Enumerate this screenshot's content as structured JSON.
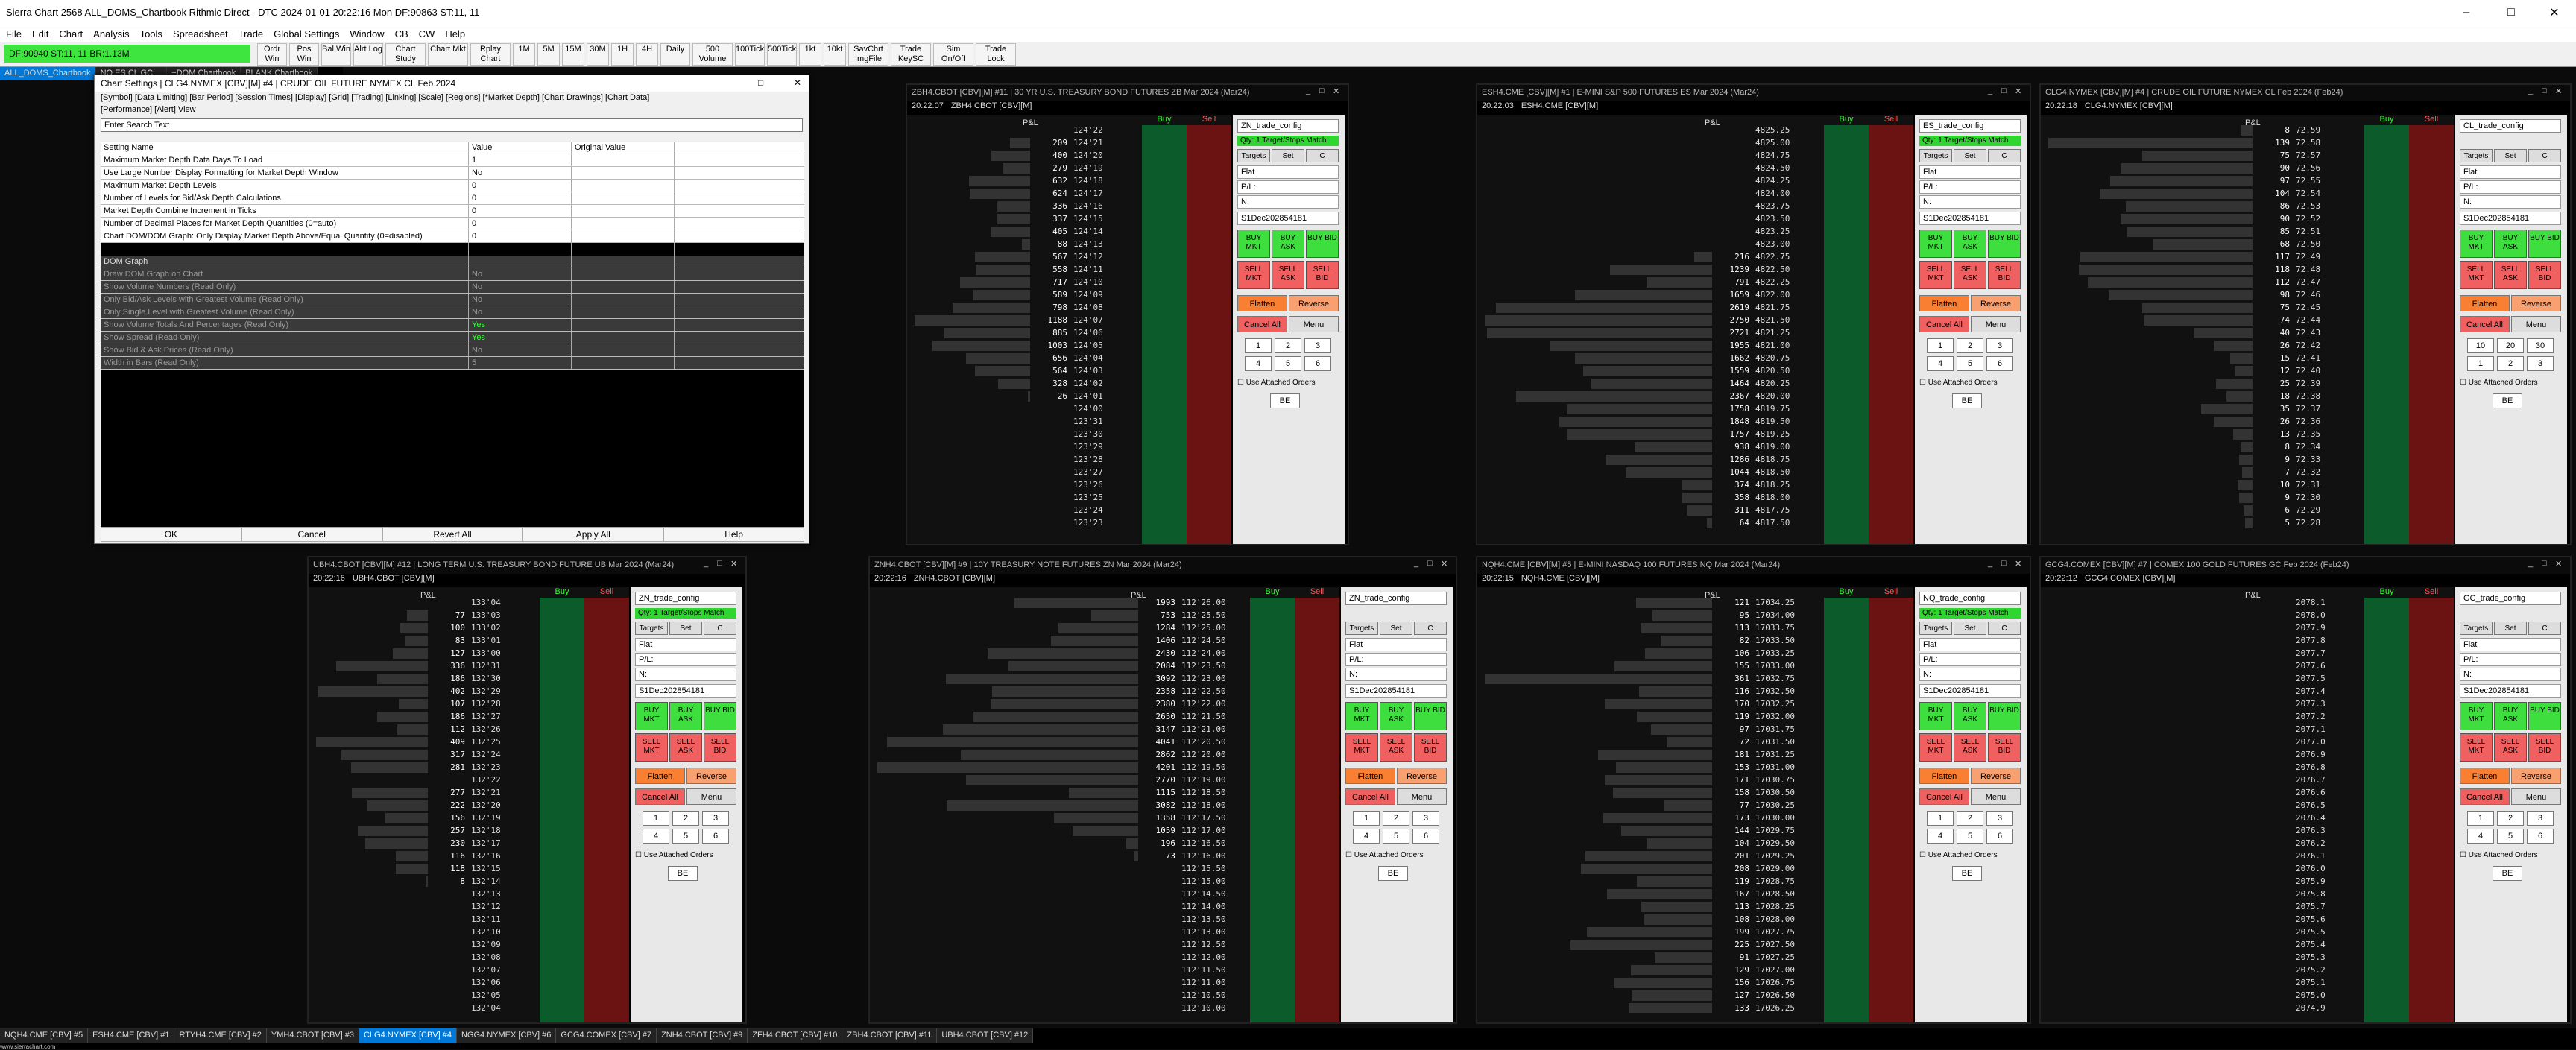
{
  "window": {
    "title": "Sierra Chart 2568 ALL_DOMS_Chartbook Rithmic Direct - DTC 2024-01-01  20:22:16 Mon  DF:90863  ST:11, 11"
  },
  "menu": [
    "File",
    "Edit",
    "Chart",
    "Analysis",
    "Tools",
    "Spreadsheet",
    "Trade",
    "Global Settings",
    "Window",
    "CB",
    "CW",
    "Help"
  ],
  "toolbar": {
    "status": "DF:90940  ST:11, 11   BR:1.13M",
    "buttons": [
      "Ordr Win",
      "Pos Win",
      "Bal Win",
      "Alrt Log",
      "Chart Study",
      "Chart Mkt",
      "Rplay Chart",
      "1M",
      "5M",
      "15M",
      "30M",
      "1H",
      "4H",
      "Daily",
      "500 Volume",
      "100Tick",
      "500Tick",
      "1kt",
      "10kt",
      "SavChrt ImgFile",
      "Trade KeySC",
      "Sim On/Off",
      "Trade Lock"
    ]
  },
  "chartbook_tabs": [
    "ALL_DOMS_Chartbook",
    "NQ ES CL GC ...",
    "+DOM Chartbook",
    "BLANK Chartbook"
  ],
  "dialog": {
    "title": "Chart Settings | CLG4.NYMEX [CBV][M] #4 | CRUDE OIL FUTURE NYMEX CL Feb 2024",
    "tabs": "[Symbol]  [Data Limiting]  [Bar Period]  [Session Times]  [Display]  [Grid]  [Trading]  [Linking]  [Scale]  [Regions]  [*Market Depth]  [Chart Drawings]  [Chart Data]",
    "tabs2": "[Performance]  [Alert]  View",
    "search_placeholder": "Enter Search Text",
    "col_setting": "Setting Name",
    "col_value": "Value",
    "col_orig": "Original Value",
    "rows": [
      {
        "name": "Maximum Market Depth Data Days To Load",
        "value": "1",
        "type": "light"
      },
      {
        "name": "Use Large Number Display Formatting for Market Depth Window",
        "value": "No",
        "type": "light"
      },
      {
        "name": "Maximum Market Depth Levels",
        "value": "0",
        "type": "light"
      },
      {
        "name": "Number of Levels for Bid/Ask Depth Calculations",
        "value": "0",
        "type": "light"
      },
      {
        "name": "Market Depth Combine Increment in Ticks",
        "value": "0",
        "type": "light"
      },
      {
        "name": "Number of Decimal Places for Market Depth Quantities (0=auto)",
        "value": "0",
        "type": "light"
      },
      {
        "name": "Chart DOM/DOM Graph: Only Display Market Depth Above/Equal Quantity (0=disabled)",
        "value": "0",
        "type": "light"
      },
      {
        "name": "",
        "value": "",
        "type": "blank"
      },
      {
        "name": "DOM Graph",
        "value": "",
        "type": "head"
      },
      {
        "name": "Draw DOM Graph on Chart",
        "value": "No",
        "type": "dark"
      },
      {
        "name": "Show Volume Numbers (Read Only)",
        "value": "No",
        "type": "dark"
      },
      {
        "name": "Only Bid/Ask Levels with Greatest Volume (Read Only)",
        "value": "No",
        "type": "dark"
      },
      {
        "name": "Only Single Level with Greatest Volume (Read Only)",
        "value": "No",
        "type": "dark"
      },
      {
        "name": "Show Volume Totals And Percentages (Read Only)",
        "value": "Yes",
        "type": "dark"
      },
      {
        "name": "Show Spread (Read Only)",
        "value": "Yes",
        "type": "dark"
      },
      {
        "name": "Show Bid & Ask Prices (Read Only)",
        "value": "No",
        "type": "dark"
      },
      {
        "name": "Width in Bars (Read Only)",
        "value": "5",
        "type": "dark"
      }
    ],
    "buttons": [
      "OK",
      "Cancel",
      "Revert All",
      "Apply All",
      "Help"
    ]
  },
  "pane_labels": {
    "targets": "Targets",
    "set": "Set",
    "c": "C",
    "flat": "Flat",
    "pl": "P/L:",
    "n": "N:",
    "account": "S1Dec202854181",
    "buy_mkt": "BUY MKT",
    "buy_ask": "BUY ASK",
    "buy_bid": "BUY BID",
    "sell_mkt": "SELL MKT",
    "sell_ask": "SELL ASK",
    "sell_bid": "SELL BID",
    "flatten": "Flatten",
    "reverse": "Reverse",
    "cancel_all": "Cancel All",
    "menu": "Menu",
    "use_attached": "Use Attached Orders",
    "be": "BE",
    "pl_header": "P&L",
    "buy": "Buy",
    "sell": "Sell"
  },
  "charts": [
    {
      "id": "zb",
      "hdr": "ZBH4.CBOT [CBV][M] #11 | 30 YR U.S. TREASURY BOND FUTURES ZB Mar 2024 (Mar24)",
      "time": "20:22:07",
      "sym": "ZBH4.CBOT [CBV][M]",
      "config": "ZN_trade_config",
      "green": "Qty: 1 Target/Stops Match",
      "nums": [
        "1",
        "2",
        "3",
        "4",
        "5",
        "6"
      ],
      "prices": [
        "124'22",
        "124'21",
        "124'20",
        "124'19",
        "124'18",
        "124'17",
        "124'16",
        "124'15",
        "124'14",
        "124'13",
        "124'12",
        "124'11",
        "124'10",
        "124'09",
        "124'08",
        "124'07",
        "124'06",
        "124'05",
        "124'04",
        "124'03",
        "124'02",
        "124'01",
        "124'00",
        "123'31",
        "123'30",
        "123'29",
        "123'28",
        "123'27",
        "123'26",
        "123'25",
        "123'24",
        "123'23",
        "123'22"
      ],
      "qty": [
        "",
        "209",
        "400",
        "279",
        "632",
        "624",
        "336",
        "337",
        "405",
        "88",
        "567",
        "558",
        "717",
        "589",
        "798",
        "1188",
        "885",
        "1003",
        "656",
        "564",
        "328",
        "26"
      ]
    },
    {
      "id": "es",
      "hdr": "ESH4.CME [CBV][M] #1 | E-MINI S&P 500 FUTURES ES Mar 2024 (Mar24)",
      "time": "20:22:03",
      "sym": "ESH4.CME [CBV][M]",
      "config": "ES_trade_config",
      "green": "Qty: 1 Target/Stops Match",
      "nums": [
        "1",
        "2",
        "3",
        "4",
        "5",
        "6"
      ],
      "prices": [
        "4825.25",
        "4825.00",
        "4824.75",
        "4824.50",
        "4824.25",
        "4824.00",
        "4823.75",
        "4823.50",
        "4823.25",
        "4823.00",
        "4822.75",
        "4822.50",
        "4822.25",
        "4822.00",
        "4821.75",
        "4821.50",
        "4821.25",
        "4821.00",
        "4820.75",
        "4820.50",
        "4820.25",
        "4820.00",
        "4819.75",
        "4819.50",
        "4819.25",
        "4819.00",
        "4818.75",
        "4818.50",
        "4818.25",
        "4818.00",
        "4817.75",
        "4817.50",
        "4817.25"
      ],
      "qty": [
        "",
        "",
        "",
        "",
        "",
        "",
        "",
        "",
        "",
        "",
        "216",
        "1239",
        "791",
        "1659",
        "2619",
        "2750",
        "2721",
        "1955",
        "1662",
        "1559",
        "1464",
        "2367",
        "1758",
        "1848",
        "1757",
        "938",
        "1286",
        "1044",
        "374",
        "358",
        "311",
        "64",
        "54"
      ]
    },
    {
      "id": "cl",
      "hdr": "CLG4.NYMEX [CBV][M] #4 | CRUDE OIL FUTURE NYMEX CL Feb 2024 (Feb24)",
      "time": "20:22:18",
      "sym": "CLG4.NYMEX [CBV][M]",
      "config": "CL_trade_config",
      "green": "",
      "nums": [
        "10",
        "20",
        "30",
        "1",
        "2",
        "3"
      ],
      "prices": [
        "72.59",
        "72.58",
        "72.57",
        "72.56",
        "72.55",
        "72.54",
        "72.53",
        "72.52",
        "72.51",
        "72.50",
        "72.49",
        "72.48",
        "72.47",
        "72.46",
        "72.45",
        "72.44",
        "72.43",
        "72.42",
        "72.41",
        "72.40",
        "72.39",
        "72.38",
        "72.37",
        "72.36",
        "72.35",
        "72.34",
        "72.33",
        "72.32",
        "72.31",
        "72.30",
        "72.29",
        "72.28",
        "72.27"
      ],
      "qty": [
        "8",
        "139",
        "75",
        "90",
        "97",
        "104",
        "86",
        "90",
        "85",
        "68",
        "117",
        "118",
        "112",
        "98",
        "75",
        "74",
        "40",
        "26",
        "15",
        "12",
        "25",
        "18",
        "35",
        "26",
        "13",
        "8",
        "9",
        "7",
        "10",
        "9",
        "6",
        "5",
        "4"
      ]
    },
    {
      "id": "ub",
      "hdr": "UBH4.CBOT [CBV][M] #12 | LONG TERM U.S. TREASURY BOND FUTURE UB Mar 2024 (Mar24)",
      "time": "20:22:16",
      "sym": "UBH4.CBOT [CBV][M]",
      "config": "ZN_trade_config",
      "green": "Qty: 1 Target/Stops Match",
      "nums": [
        "1",
        "2",
        "3",
        "4",
        "5",
        "6"
      ],
      "prices": [
        "133'04",
        "133'03",
        "133'02",
        "133'01",
        "133'00",
        "132'31",
        "132'30",
        "132'29",
        "132'28",
        "132'27",
        "132'26",
        "132'25",
        "132'24",
        "132'23",
        "132'22",
        "132'21",
        "132'20",
        "132'19",
        "132'18",
        "132'17",
        "132'16",
        "132'15",
        "132'14",
        "132'13",
        "132'12",
        "132'11",
        "132'10",
        "132'09",
        "132'08",
        "132'07",
        "132'06",
        "132'05",
        "132'04"
      ],
      "qty": [
        "",
        "77",
        "100",
        "83",
        "127",
        "336",
        "186",
        "402",
        "107",
        "186",
        "112",
        "409",
        "317",
        "281",
        "",
        "277",
        "222",
        "156",
        "257",
        "230",
        "116",
        "118",
        "8"
      ]
    },
    {
      "id": "zn",
      "hdr": "ZNH4.CBOT [CBV][M] #9 | 10Y TREASURY NOTE FUTURES ZN Mar 2024 (Mar24)",
      "time": "20:22:16",
      "sym": "ZNH4.CBOT [CBV][M]",
      "config": "ZN_trade_config",
      "green": "",
      "nums": [
        "1",
        "2",
        "3",
        "4",
        "5",
        "6"
      ],
      "prices": [
        "112'26.00",
        "112'25.50",
        "112'25.00",
        "112'24.50",
        "112'24.00",
        "112'23.50",
        "112'23.00",
        "112'22.50",
        "112'22.00",
        "112'21.50",
        "112'21.00",
        "112'20.50",
        "112'20.00",
        "112'19.50",
        "112'19.00",
        "112'18.50",
        "112'18.00",
        "112'17.50",
        "112'17.00",
        "112'16.50",
        "112'16.00",
        "112'15.50",
        "112'15.00",
        "112'14.50",
        "112'14.00",
        "112'13.50",
        "112'13.00",
        "112'12.50",
        "112'12.00",
        "112'11.50",
        "112'11.00",
        "112'10.50",
        "112'10.00"
      ],
      "qty": [
        "1993",
        "753",
        "1284",
        "1406",
        "2430",
        "2084",
        "3092",
        "2358",
        "2380",
        "2650",
        "3147",
        "4041",
        "2862",
        "4201",
        "2770",
        "1115",
        "3082",
        "1358",
        "1059",
        "196",
        "73"
      ]
    },
    {
      "id": "nq",
      "hdr": "NQH4.CME [CBV][M] #5 | E-MINI NASDAQ 100 FUTURES NQ Mar 2024 (Mar24)",
      "time": "20:22:15",
      "sym": "NQH4.CME [CBV][M]",
      "config": "NQ_trade_config",
      "green": "Qty: 1 Target/Stops Match",
      "nums": [
        "1",
        "2",
        "3",
        "4",
        "5",
        "6"
      ],
      "prices": [
        "17034.25",
        "17034.00",
        "17033.75",
        "17033.50",
        "17033.25",
        "17033.00",
        "17032.75",
        "17032.50",
        "17032.25",
        "17032.00",
        "17031.75",
        "17031.50",
        "17031.25",
        "17031.00",
        "17030.75",
        "17030.50",
        "17030.25",
        "17030.00",
        "17029.75",
        "17029.50",
        "17029.25",
        "17029.00",
        "17028.75",
        "17028.50",
        "17028.25",
        "17028.00",
        "17027.75",
        "17027.50",
        "17027.25",
        "17027.00",
        "17026.75",
        "17026.50",
        "17026.25"
      ],
      "qty": [
        "121",
        "95",
        "113",
        "82",
        "106",
        "155",
        "361",
        "116",
        "170",
        "119",
        "97",
        "72",
        "181",
        "153",
        "171",
        "158",
        "77",
        "173",
        "144",
        "104",
        "201",
        "208",
        "119",
        "167",
        "113",
        "108",
        "199",
        "225",
        "91",
        "129",
        "156",
        "127",
        "133"
      ]
    },
    {
      "id": "gc",
      "hdr": "GCG4.COMEX [CBV][M] #7 | COMEX 100 GOLD FUTURES GC Feb 2024 (Feb24)",
      "time": "20:22:12",
      "sym": "GCG4.COMEX [CBV][M]",
      "config": "GC_trade_config",
      "green": "",
      "nums": [
        "1",
        "2",
        "3",
        "4",
        "5",
        "6"
      ],
      "prices": [
        "2078.1",
        "2078.0",
        "2077.9",
        "2077.8",
        "2077.7",
        "2077.6",
        "2077.5",
        "2077.4",
        "2077.3",
        "2077.2",
        "2077.1",
        "2077.0",
        "2076.9",
        "2076.8",
        "2076.7",
        "2076.6",
        "2076.5",
        "2076.4",
        "2076.3",
        "2076.2",
        "2076.1",
        "2076.0",
        "2075.9",
        "2075.8",
        "2075.7",
        "2075.6",
        "2075.5",
        "2075.4",
        "2075.3",
        "2075.2",
        "2075.1",
        "2075.0",
        "2074.9"
      ],
      "qty": [
        "",
        "",
        "",
        "",
        "",
        "",
        "",
        "",
        "",
        "",
        "",
        "",
        "",
        "",
        "",
        "",
        "",
        "",
        "",
        "",
        "",
        "",
        "",
        "",
        "",
        "",
        "",
        "",
        "",
        "",
        "",
        "",
        ""
      ]
    }
  ],
  "bottom_tabs": [
    {
      "label": "NQH4.CME [CBV] #5",
      "active": false
    },
    {
      "label": "ESH4.CME [CBV] #1",
      "active": false
    },
    {
      "label": "RTYH4.CME [CBV] #2",
      "active": false
    },
    {
      "label": "YMH4.CBOT [CBV] #3",
      "active": false
    },
    {
      "label": "CLG4.NYMEX [CBV] #4",
      "active": true
    },
    {
      "label": "NGG4.NYMEX [CBV] #6",
      "active": false
    },
    {
      "label": "GCG4.COMEX [CBV] #7",
      "active": false
    },
    {
      "label": "ZNH4.CBOT [CBV] #9",
      "active": false
    },
    {
      "label": "ZFH4.CBOT [CBV] #10",
      "active": false
    },
    {
      "label": "ZBH4.CBOT [CBV] #11",
      "active": false
    },
    {
      "label": "UBH4.CBOT [CBV] #12",
      "active": false
    }
  ],
  "footer": "www.sierrachart.com",
  "colors": {
    "status_green": "#3fe53f",
    "active_tab": "#0078d7",
    "buy": "#0b5b2b",
    "sell": "#6b1313",
    "flatten": "#f97f32"
  }
}
